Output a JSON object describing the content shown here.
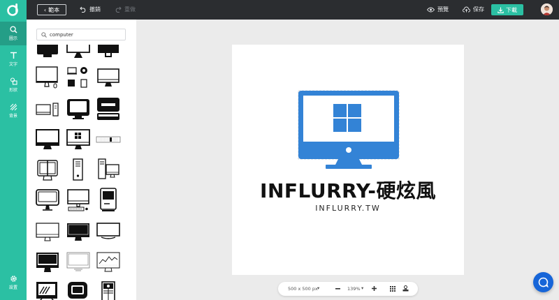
{
  "topbar": {
    "back_label": "範本",
    "undo_label": "撤銷",
    "redo_label": "重做",
    "preview_label": "預覽",
    "save_label": "保存",
    "download_label": "下載"
  },
  "rail": {
    "items": [
      {
        "label": "圖示",
        "icon": "search-icon"
      },
      {
        "label": "文字",
        "icon": "text-icon"
      },
      {
        "label": "形狀",
        "icon": "shapes-icon"
      },
      {
        "label": "背景",
        "icon": "background-icon"
      },
      {
        "label": "設置",
        "icon": "gear-icon"
      }
    ]
  },
  "panel": {
    "search_value": "computer"
  },
  "canvas": {
    "title": "INFLURRY-硬炫風",
    "subtitle": "INFLURRY.TW",
    "icon_color": "#3383d6"
  },
  "zoombar": {
    "size_label": "500 x 500 px",
    "zoom_label": "139%"
  },
  "colors": {
    "accent": "#2bc0a3",
    "topbar": "#2b2d30",
    "help": "#1665d8"
  }
}
